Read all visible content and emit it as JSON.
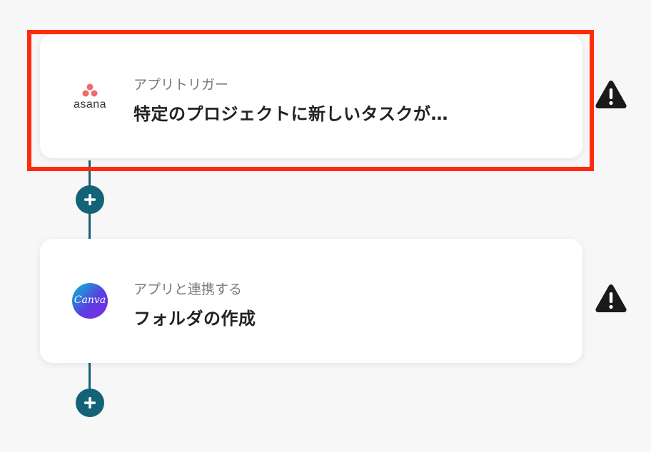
{
  "flow": {
    "steps": [
      {
        "app": "asana",
        "subtitle": "アプリトリガー",
        "title": "特定のプロジェクトに新しいタスクが…",
        "icon": "asana-logo-icon",
        "logo_text": "asana",
        "highlighted": true,
        "warning": true
      },
      {
        "app": "Canva",
        "subtitle": "アプリと連携する",
        "title": "フォルダの作成",
        "icon": "canva-logo-icon",
        "logo_text": "Canva",
        "highlighted": false,
        "warning": true
      }
    ],
    "add_buttons": 2
  },
  "colors": {
    "background": "#f7f7f7",
    "connector": "#136377",
    "highlight": "#ff2a0c",
    "asana_coral": "#f06a6a",
    "canva_gradient_start": "#00c4cc",
    "canva_gradient_end": "#7d2ae8",
    "warning": "#1a1a1a"
  }
}
